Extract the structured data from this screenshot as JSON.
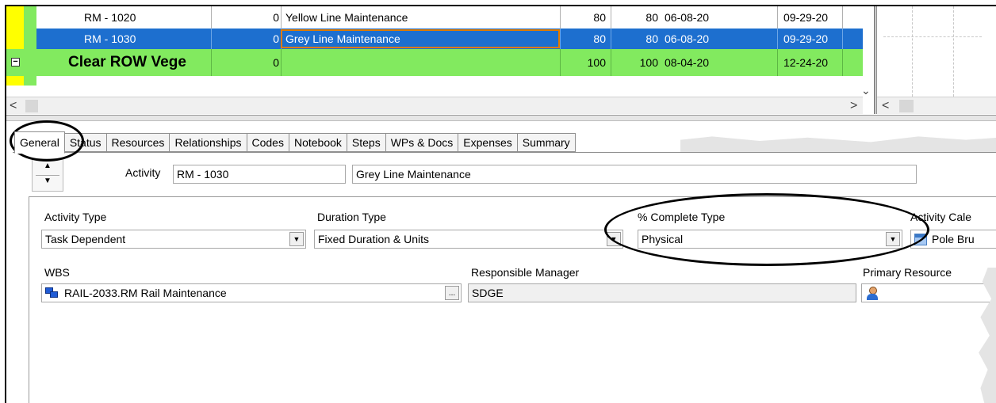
{
  "grid": {
    "rows": [
      {
        "id": "RM - 1020",
        "col2": "0",
        "name": "Yellow Line Maintenance",
        "c4": "80",
        "c5": "80",
        "start": "06-08-20",
        "finish": "09-29-20"
      },
      {
        "id": "RM - 1030",
        "col2": "0",
        "name": "Grey Line Maintenance",
        "c4": "80",
        "c5": "80",
        "start": "06-08-20",
        "finish": "09-29-20"
      },
      {
        "id": "Clear ROW Vege",
        "col2": "0",
        "name": "",
        "c4": "100",
        "c5": "100",
        "start": "08-04-20",
        "finish": "12-24-20"
      }
    ],
    "expand_symbol": "−",
    "scroll_left": "<",
    "scroll_right": ">",
    "scroll_down": "⌄"
  },
  "tabs": [
    "General",
    "Status",
    "Resources",
    "Relationships",
    "Codes",
    "Notebook",
    "Steps",
    "WPs & Docs",
    "Expenses",
    "Summary"
  ],
  "activity": {
    "label": "Activity",
    "id": "RM - 1030",
    "name": "Grey Line Maintenance"
  },
  "general": {
    "activity_type_label": "Activity Type",
    "activity_type_value": "Task Dependent",
    "duration_type_label": "Duration Type",
    "duration_type_value": "Fixed Duration & Units",
    "pct_complete_type_label": "% Complete Type",
    "pct_complete_type_value": "Physical",
    "activity_calendar_label": "Activity Cale",
    "activity_calendar_value": "Pole Bru",
    "wbs_label": "WBS",
    "wbs_value": "RAIL-2033.RM  Rail Maintenance",
    "resp_manager_label": "Responsible Manager",
    "resp_manager_value": "SDGE",
    "primary_resource_label": "Primary Resource",
    "ellipsis": "...",
    "dropdown_arrow": "▼"
  },
  "colors": {
    "selected_row": "#1d6fcf",
    "wbs_row": "#82ea5f",
    "marker": "#ffff00",
    "highlight_border": "#e07a00"
  }
}
